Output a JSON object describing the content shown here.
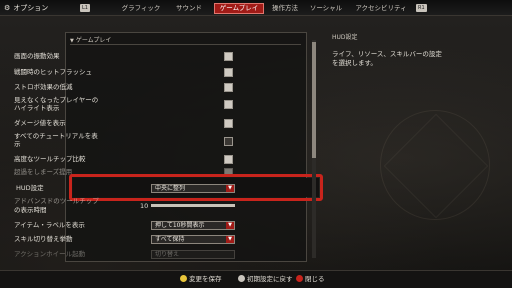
{
  "window": {
    "title": "オプション",
    "gear_icon": "gear-icon"
  },
  "topbar": {
    "left_button": "L1",
    "right_button": "R1",
    "tabs": [
      {
        "label": "グラフィック"
      },
      {
        "label": "サウンド"
      },
      {
        "label": "ゲームプレイ"
      },
      {
        "label": "操作方法"
      },
      {
        "label": "ソーシャル"
      },
      {
        "label": "アクセシビリティ"
      }
    ]
  },
  "panel": {
    "header": "ゲームプレイ",
    "rows": [
      {
        "label": "画面の振動効果"
      },
      {
        "label": "戦闘時のヒットフラッシュ"
      },
      {
        "label": "ストロボ効果の低減"
      },
      {
        "label": "見えなくなったプレイヤーの"
      },
      {
        "label": "ハイライト表示"
      },
      {
        "label": "ダメージ値を表示"
      },
      {
        "label": "すべてのチュートリアルを表"
      },
      {
        "label": "示"
      },
      {
        "label": "高度なツールチップ比較"
      },
      {
        "label": "超過をしまーズ提用"
      }
    ],
    "hud": {
      "label": "HUD設定",
      "value": "中央に整列"
    },
    "slider_row": {
      "label1": "アドバンスドのツールチップ",
      "label2": "の表示時間",
      "value": "10"
    },
    "item_labels": {
      "label": "アイテム・ラベルを表示",
      "value": "押して10秒間表示"
    },
    "skill_swap": {
      "label": "スキル切り替え挙動",
      "value": "すべて保持"
    },
    "action_wheel": {
      "label": "アクションホイール起動",
      "value": "切り替え"
    }
  },
  "info": {
    "title": "HUD設定",
    "description_line1": "ライフ、リソース、スキルバーの設定",
    "description_line2": "を選択します。"
  },
  "bottombar": {
    "save": "変更を保存",
    "reset": "初期設定に戻す",
    "close": "閉じる"
  },
  "colors": {
    "accent": "#a11b17",
    "highlight": "#c8241c",
    "save_dot": "#e9c53a",
    "reset_dot": "#c9c4bc",
    "close_dot": "#c8241c"
  }
}
